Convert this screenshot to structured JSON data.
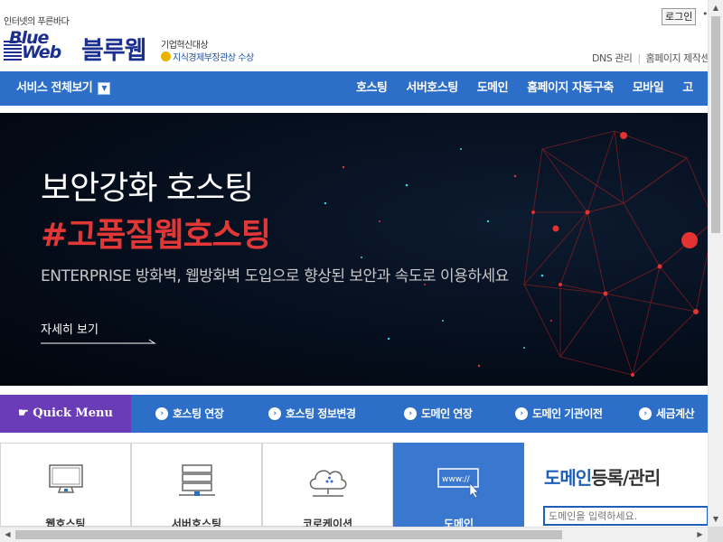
{
  "header": {
    "tagline": "인터넷의 푸른바다",
    "logo_line1": "Blue",
    "logo_line2": "Web",
    "brand_name": "블루웹",
    "award_title": "기업혁신대상",
    "award_sub": "지식경제부장관상 수상",
    "login_label": "로그인",
    "login_dot": "•",
    "util_links": [
      "DNS 관리",
      "홈페이지 제작센"
    ]
  },
  "nav": {
    "all_services": "서비스 전체보기",
    "items": [
      "호스팅",
      "서버호스팅",
      "도메인",
      "홈페이지 자동구축",
      "모바일",
      "고"
    ]
  },
  "hero": {
    "title": "보안강화 호스팅",
    "subtitle": "#고품질웹호스팅",
    "description": "ENTERPRISE 방화벽, 웹방화벽 도입으로 향상된 보안과 속도로 이용하세요",
    "more_link": "자세히 보기"
  },
  "quick_menu": {
    "label": "☛ Quick Menu",
    "items": [
      "호스팅 연장",
      "호스팅 정보변경",
      "도메인 연장",
      "도메인 기관이전",
      "세금계산"
    ]
  },
  "services": [
    {
      "label": "웹호스팅",
      "icon": "monitor-icon"
    },
    {
      "label": "서버호스팅",
      "icon": "server-icon"
    },
    {
      "label": "코로케이션",
      "icon": "cloud-icon"
    },
    {
      "label": "도메인",
      "icon": "www-cursor-icon"
    }
  ],
  "domain_search": {
    "title_blue": "도메인",
    "title_rest": "등록/관리",
    "placeholder": "도메인을 입력하세요."
  },
  "colors": {
    "nav_blue": "#2c6ec8",
    "quick_purple": "#6a3cb8",
    "brand_navy": "#1b2f8f",
    "hero_red": "#e23737"
  }
}
